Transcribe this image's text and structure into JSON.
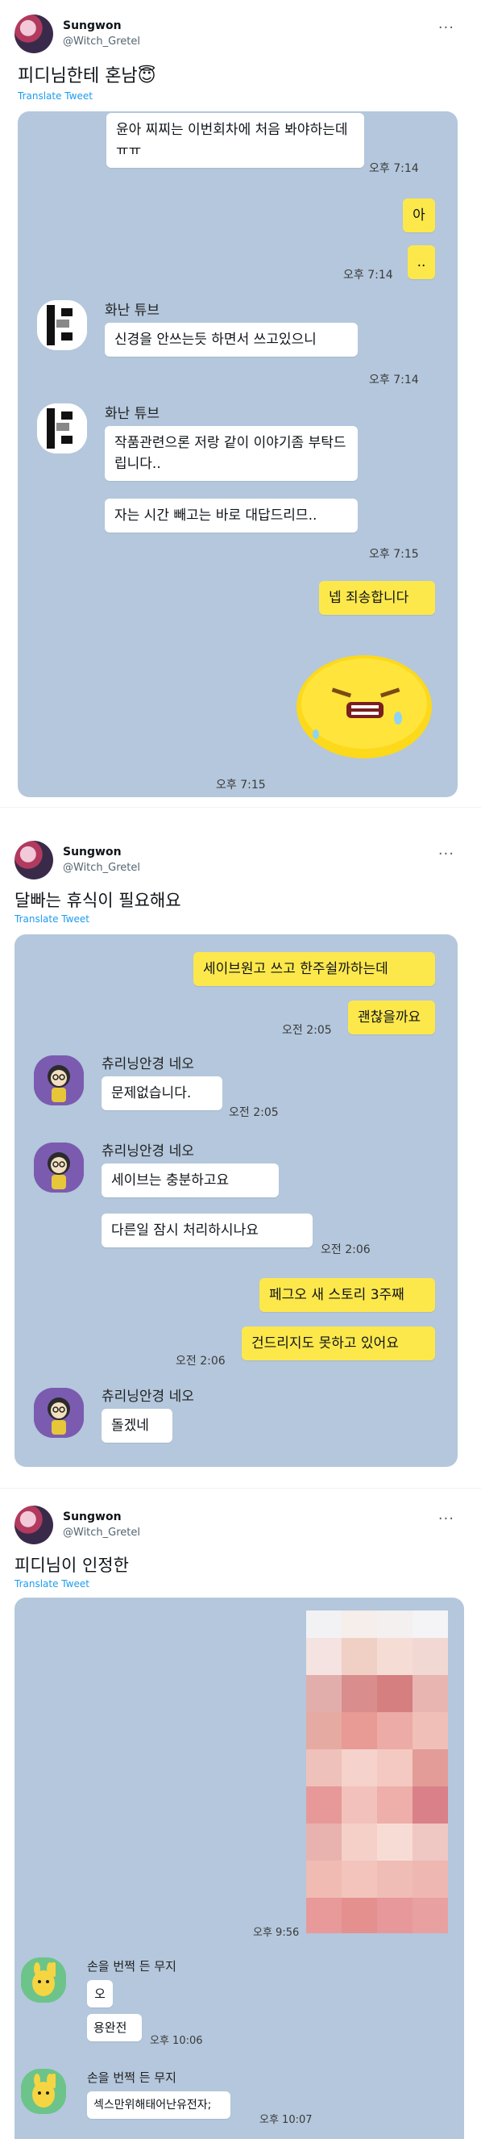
{
  "tweets": [
    {
      "user": {
        "name": "Sungwon",
        "handle": "@Witch_Gretel"
      },
      "more": "···",
      "text": "피디님한테 혼남😇",
      "translate": "Translate Tweet",
      "messages": {
        "m1": "윤아 찌찌는 이번회차에 처음 봐야하는데 ㅠㅠ",
        "t1": "오후 7:14",
        "m2": "아",
        "m3": "..",
        "t2": "오후 7:14",
        "sender1": "화난 튜브",
        "m4": "신경을 안쓰는듯 하면서 쓰고있으니",
        "t3": "오후 7:14",
        "sender2": "화난 튜브",
        "m5": "작품관련으론 저랑 같이 이야기좀 부탁드립니다..",
        "m6": "자는 시간 빼고는 바로 대답드리므..",
        "t4": "오후 7:15",
        "m7": "넵 죄송합니다",
        "t5": "오후 7:15"
      }
    },
    {
      "user": {
        "name": "Sungwon",
        "handle": "@Witch_Gretel"
      },
      "more": "···",
      "text": "달빠는 휴식이 필요해요",
      "translate": "Translate Tweet",
      "messages": {
        "m1": "세이브원고 쓰고 한주쉴까하는데",
        "m2": "괜찮을까요",
        "t1": "오전 2:05",
        "sender1": "츄리닝안경 네오",
        "m3": "문제없습니다.",
        "t2": "오전 2:05",
        "sender2": "츄리닝안경 네오",
        "m4": "세이브는 충분하고요",
        "m5": "다른일 잠시 처리하시나요",
        "t3": "오전 2:06",
        "m6": "페그오 새 스토리 3주째",
        "m7": "건드리지도 못하고 있어요",
        "t4": "오전 2:06",
        "sender3": "츄리닝안경 네오",
        "m8": "돌겠네"
      }
    },
    {
      "user": {
        "name": "Sungwon",
        "handle": "@Witch_Gretel"
      },
      "more": "···",
      "text": "피디님이 인정한",
      "translate": "Translate Tweet",
      "messages": {
        "t1": "오후 9:56",
        "sender1": "손을 번쩍 든 무지",
        "m1": "오",
        "m2": "용완전",
        "t2": "오후 10:06",
        "sender2": "손을 번쩍 든 무지",
        "m3": "섹스만위해태어난유전자;",
        "t3": "오후 10:07"
      }
    }
  ]
}
